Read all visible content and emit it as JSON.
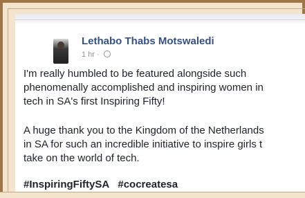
{
  "post": {
    "author": "Lethabo Thabs Motswaledi",
    "time": "1 hr · ",
    "paragraph1": "I'm really humbled to be featured alongside such\nphenomenally accomplished and inspiring women in\ntech in SA's first Inspiring Fifty!",
    "paragraph2": "A huge thank you to the Kingdom of the Netherlands\nin SA for such an incredible initiative to inspire girls t\ntake on the world of tech.",
    "hashtags": [
      "#InspiringFiftySA",
      "#cocreatesa"
    ]
  },
  "colors": {
    "author": "#365080",
    "frame": "#a07545",
    "text": "#1d2129"
  },
  "icons": {
    "privacy": "globe-icon",
    "avatar": "profile-photo"
  }
}
